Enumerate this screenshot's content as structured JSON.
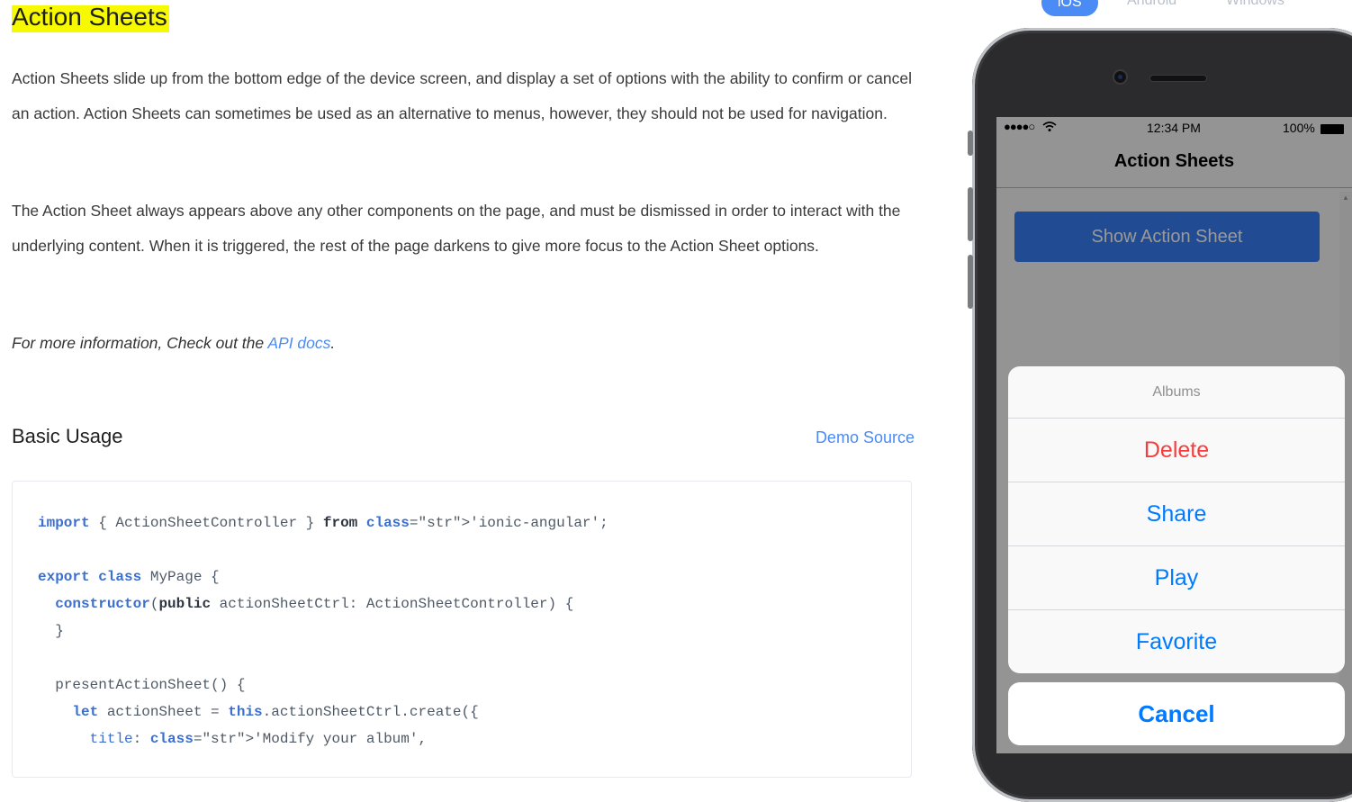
{
  "doc": {
    "title": "Action Sheets",
    "para1": "Action Sheets slide up from the bottom edge of the device screen, and display a set of options with the ability to confirm or cancel an action. Action Sheets can sometimes be used as an alternative to menus, however, they should not be used for navigation.",
    "para2": "The Action Sheet always appears above any other components on the page, and must be dismissed in order to interact with the underlying content. When it is triggered, the rest of the page darkens to give more focus to the Action Sheet options.",
    "para3_prefix": "For more information, Check out the ",
    "para3_link": "API docs",
    "para3_suffix": ".",
    "section_title": "Basic Usage",
    "demo_source": "Demo Source"
  },
  "code": {
    "lines": [
      "import { ActionSheetController } from 'ionic-angular';",
      "",
      "export class MyPage {",
      "  constructor(public actionSheetCtrl: ActionSheetController) {",
      "  }",
      "",
      "  presentActionSheet() {",
      "    let actionSheet = this.actionSheetCtrl.create({",
      "      title: 'Modify your album',"
    ]
  },
  "platforms": {
    "ios": "iOS",
    "android": "Android",
    "windows": "Windows",
    "active": "iOS"
  },
  "device": {
    "signal": "●●●●○",
    "time": "12:34 PM",
    "battery": "100%",
    "nav_title": "Action Sheets",
    "button_label": "Show Action Sheet",
    "sheet_title": "Albums",
    "options": [
      "Delete",
      "Share",
      "Play",
      "Favorite"
    ],
    "cancel": "Cancel"
  },
  "colors": {
    "accent": "#4a8bf5",
    "ionic_primary": "#387ef5",
    "ios_blue": "#007aff",
    "destructive": "#f53d3d",
    "title_highlight": "#f6f900"
  }
}
